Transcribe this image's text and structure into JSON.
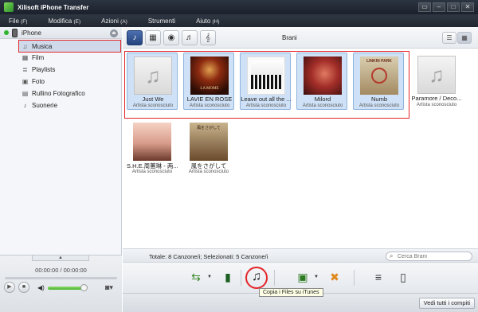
{
  "window": {
    "title": "Xilisoft iPhone Transfer",
    "controls": [
      "▭",
      "–",
      "□",
      "✕"
    ]
  },
  "menu": [
    {
      "label": "File",
      "accel": "(F)"
    },
    {
      "label": "Modifica",
      "accel": "(E)"
    },
    {
      "label": "Azioni",
      "accel": "(A)"
    },
    {
      "label": "Strumenti",
      "accel": ""
    },
    {
      "label": "Aiuto",
      "accel": "(H)"
    }
  ],
  "sidebar": {
    "device": {
      "label": "iPhone",
      "status_color": "#2eb52e"
    },
    "items": [
      {
        "label": "Musica",
        "icon": "music-note-icon",
        "glyph": "♫",
        "selected": true
      },
      {
        "label": "Film",
        "icon": "film-icon",
        "glyph": "▦"
      },
      {
        "label": "Playlists",
        "icon": "playlist-icon",
        "glyph": "≣"
      },
      {
        "label": "Foto",
        "icon": "photo-icon",
        "glyph": "▣"
      },
      {
        "label": "Rullino Fotografico",
        "icon": "camera-roll-icon",
        "glyph": "▤"
      },
      {
        "label": "Suonerie",
        "icon": "ringtone-icon",
        "glyph": "♪"
      }
    ]
  },
  "player": {
    "time": "00:00:00 / 00:00:00",
    "volume": 0.9
  },
  "main": {
    "section_title": "Brani",
    "tabs": [
      {
        "icon": "music-tab-icon",
        "glyph": "♪",
        "active": true
      },
      {
        "icon": "video-tab-icon",
        "glyph": "▦",
        "active": false
      },
      {
        "icon": "podcast-tab-icon",
        "glyph": "◉",
        "active": false
      },
      {
        "icon": "guitar-tab-icon",
        "glyph": "♬",
        "active": false
      },
      {
        "icon": "treble-clef-tab-icon",
        "glyph": "𝄞",
        "active": false
      }
    ]
  },
  "songs": [
    {
      "title": "Just We",
      "artist": "Artista sconosciuto",
      "selected": true,
      "art": "placeholder"
    },
    {
      "title": "LAVIE EN ROSE",
      "artist": "Artista sconosciuto",
      "selected": true,
      "art": "vie",
      "art_text": "LA MOME"
    },
    {
      "title": "Leave out all the ...",
      "artist": "Artista sconosciuto",
      "selected": true,
      "art": "leave"
    },
    {
      "title": "Milord",
      "artist": "Artista sconosciuto",
      "selected": true,
      "art": "milord"
    },
    {
      "title": "Numb",
      "artist": "Artista sconosciuto",
      "selected": true,
      "art": "numb",
      "art_text": "LINKIN PARK"
    },
    {
      "title": "Paramore / Deco...",
      "artist": "Artista sconosciuto",
      "selected": false,
      "art": "placeholder"
    },
    {
      "title": "S.H.E.周蕙琳 - 两...",
      "artist": "Artista sconosciuto",
      "selected": false,
      "art": "she"
    },
    {
      "title": "風をさがして",
      "artist": "Artista sconosciuto",
      "selected": false,
      "art": "kaze",
      "art_text": "風をさがして"
    }
  ],
  "status": {
    "text": "Totale: 8 Canzone/i; Selezionati: 5 Canzone/i"
  },
  "search": {
    "placeholder": "Cerca Brani"
  },
  "toolbar": {
    "buttons": [
      {
        "name": "export-to-pc-button",
        "glyph": "⇆",
        "color": "#3d8b2c"
      },
      {
        "name": "backup-button",
        "glyph": "▮",
        "color": "#1b5e20"
      },
      {
        "name": "copy-to-itunes-button",
        "glyph": "♫",
        "color": "#222"
      },
      {
        "name": "add-to-device-button",
        "glyph": "▣",
        "color": "#2a7a1e"
      },
      {
        "name": "delete-button",
        "glyph": "✖",
        "color": "#e08a1e"
      },
      {
        "name": "add-to-playlist-button",
        "glyph": "≡",
        "color": "#333"
      },
      {
        "name": "device-info-button",
        "glyph": "▯",
        "color": "#333"
      }
    ]
  },
  "tooltip": "Copia i Files su iTunes",
  "tasks_button": "Vedi tutti i compiti"
}
